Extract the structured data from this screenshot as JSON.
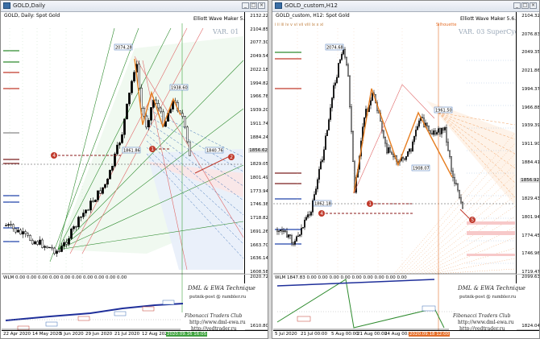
{
  "left": {
    "title": "GOLD,Daily",
    "symbol_label": "GOLD, Daily: Spot Gold",
    "indicator_label": "Elliott Wave Maker 5.6.1.5",
    "variant_label": "VAR. 01",
    "price_ticks": [
      "2132.22",
      "2104.85",
      "2077.30",
      "2049.54",
      "2022.18",
      "1994.82",
      "1966.78",
      "1939.20",
      "1911.74",
      "1884.24",
      "1856.62",
      "1829.05",
      "1801.49",
      "1773.94",
      "1746.38",
      "1718.82",
      "1691.26",
      "1663.70",
      "1636.14",
      "1608.58"
    ],
    "highlight_price": "1856.62",
    "sub_ticks": [
      "2020.72",
      "1610.80"
    ],
    "time_ticks": [
      "22 Apr 2020",
      "14 May 2020",
      "5 Jun 2020",
      "29 Jun 2020",
      "21 Jul 2020",
      "12 Aug 2020",
      "3 Sep 2020"
    ],
    "highlight_time": "2020.09.16 16:05",
    "wlm_header": "WLM 0.00 0.00 0.00 0.00 0.00 0.00 0.00 0.00 0.00 0.00",
    "price_boxes": [
      "2074.28",
      "1861.86",
      "1840.76",
      "1938.60"
    ],
    "credits": {
      "line1": "DML & EWA Technique",
      "line2": "putnik-post @ rambler.ru",
      "line3": "Fibonacci Traders Club",
      "line4": "http://www.dml-ewa.ru",
      "line5": "http://vedtrader.ru"
    }
  },
  "right": {
    "title": "GOLD_custom,H12",
    "symbol_label": "GOLD_custom, H12: Spot Gold",
    "indicator_label": "Elliott Wave Maker 5.6.1.5",
    "variant_label": "VAR. 03 SuperCycle",
    "top_letters": "i  ii  iii  iv  v  vi  vii  viii  ix  x  xi",
    "price_ticks": [
      "2104.32",
      "2076.83",
      "2049.35",
      "2021.86",
      "1994.37",
      "1966.88",
      "1939.39",
      "1911.90",
      "1884.41",
      "1856.92",
      "1829.43",
      "1801.94",
      "1774.45",
      "1746.96",
      "1719.47"
    ],
    "highlight_price": "1856.92",
    "sub_ticks": [
      "2099.63",
      "1824.04"
    ],
    "time_ticks": [
      "5 Jul 2020",
      "21 Jul 00:00",
      "5 Aug 00:00",
      "21 Aug 00:00",
      "6 Aug 16:00",
      "24 Aug 00:00",
      "3 Sep 00:00"
    ],
    "highlight_time": "2020.09.18 12:00",
    "wlm_header": "WLM 1847.83 0.00 0.00 0.00 0.00 0.00 0.00 0.00 0.00 0.00",
    "price_boxes": [
      "2074.68",
      "1961.50",
      "1862.18",
      "1908.07"
    ],
    "vline_label": "Silhouette",
    "credits": {
      "line1": "DML & EWA Technique",
      "line2": "putnik-post @ rambler.ru",
      "line3": "Fibonacci Traders Club",
      "line4": "http://www.dml-ewa.ru",
      "line5": "http://vedtrader.ru"
    }
  },
  "colors": {
    "bull": "#000000",
    "bear": "#ffffff",
    "green_channel": "#2e8b2e",
    "red_channel": "#c0392b",
    "blue_channel": "#3b6fb6",
    "orange_wave": "#e67e22",
    "accent_green": "#3fa33f",
    "accent_orange": "#e46f2a"
  },
  "icons": [
    "chart-window-icon",
    "minimize-icon",
    "maximize-icon",
    "close-icon"
  ]
}
